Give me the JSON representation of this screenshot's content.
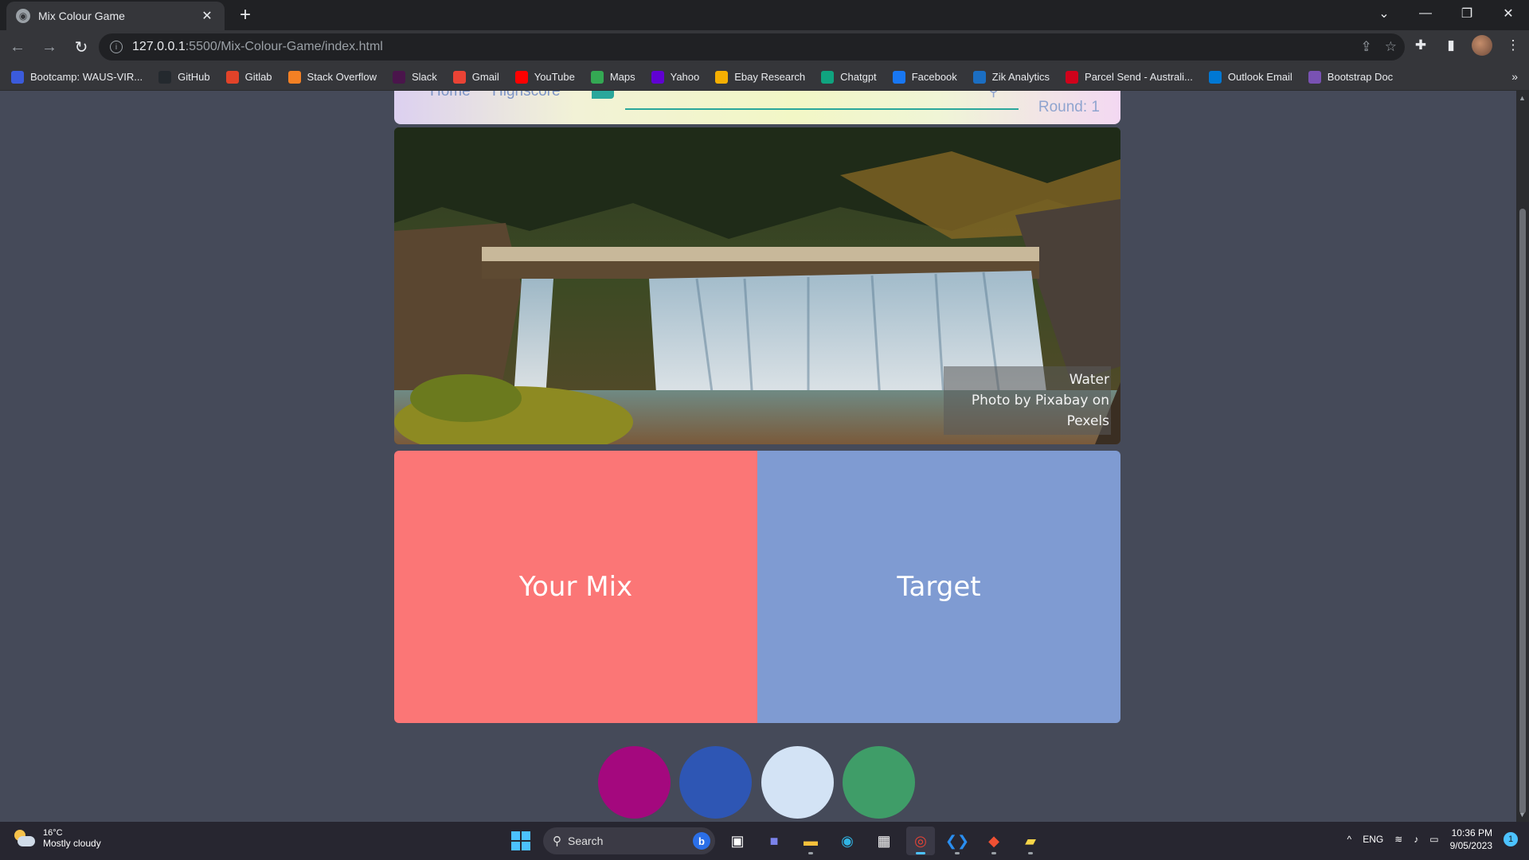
{
  "browser": {
    "tab_title": "Mix Colour Game",
    "url_host": "127.0.0.1",
    "url_path": ":5500/Mix-Colour-Game/index.html"
  },
  "bookmarks": [
    {
      "label": "Bootcamp: WAUS-VIR...",
      "icon": "bootcamp-icon",
      "color": "#3b5bdb"
    },
    {
      "label": "GitHub",
      "icon": "github-icon",
      "color": "#24292e"
    },
    {
      "label": "Gitlab",
      "icon": "gitlab-icon",
      "color": "#e24329"
    },
    {
      "label": "Stack Overflow",
      "icon": "stackoverflow-icon",
      "color": "#f48024"
    },
    {
      "label": "Slack",
      "icon": "slack-icon",
      "color": "#4a154b"
    },
    {
      "label": "Gmail",
      "icon": "gmail-icon",
      "color": "#ea4335"
    },
    {
      "label": "YouTube",
      "icon": "youtube-icon",
      "color": "#ff0000"
    },
    {
      "label": "Maps",
      "icon": "maps-icon",
      "color": "#34a853"
    },
    {
      "label": "Yahoo",
      "icon": "yahoo-icon",
      "color": "#6001d2"
    },
    {
      "label": "Ebay Research",
      "icon": "ebay-icon",
      "color": "#f5af02"
    },
    {
      "label": "Chatgpt",
      "icon": "chatgpt-icon",
      "color": "#10a37f"
    },
    {
      "label": "Facebook",
      "icon": "facebook-icon",
      "color": "#1877f2"
    },
    {
      "label": "Zik Analytics",
      "icon": "zik-icon",
      "color": "#1b6ec2"
    },
    {
      "label": "Parcel Send - Australi...",
      "icon": "parcelsend-icon",
      "color": "#d0021b"
    },
    {
      "label": "Outlook Email",
      "icon": "outlook-icon",
      "color": "#0078d4"
    },
    {
      "label": "Bootstrap Doc",
      "icon": "bootstrap-icon",
      "color": "#7952b3"
    }
  ],
  "game": {
    "nav_home": "Home",
    "nav_highscore": "Highscore",
    "round_label": "Round: 1",
    "photo_title": "Water",
    "photo_credit": "Photo by Pixabay on Pexels",
    "mix_label": "Your Mix",
    "target_label": "Target",
    "mix_color": "#fb7676",
    "target_color": "#7f9bd2",
    "swatches": [
      {
        "name": "magenta",
        "color": "#a4087e"
      },
      {
        "name": "blue",
        "color": "#2e56b4"
      },
      {
        "name": "light-blue",
        "color": "#d3e3f5"
      },
      {
        "name": "green",
        "color": "#3f9d68"
      }
    ]
  },
  "taskbar": {
    "temperature": "16°C",
    "weather_text": "Mostly cloudy",
    "search_placeholder": "Search",
    "language": "ENG",
    "time": "10:36 PM",
    "date": "9/05/2023",
    "notification_count": "1"
  }
}
